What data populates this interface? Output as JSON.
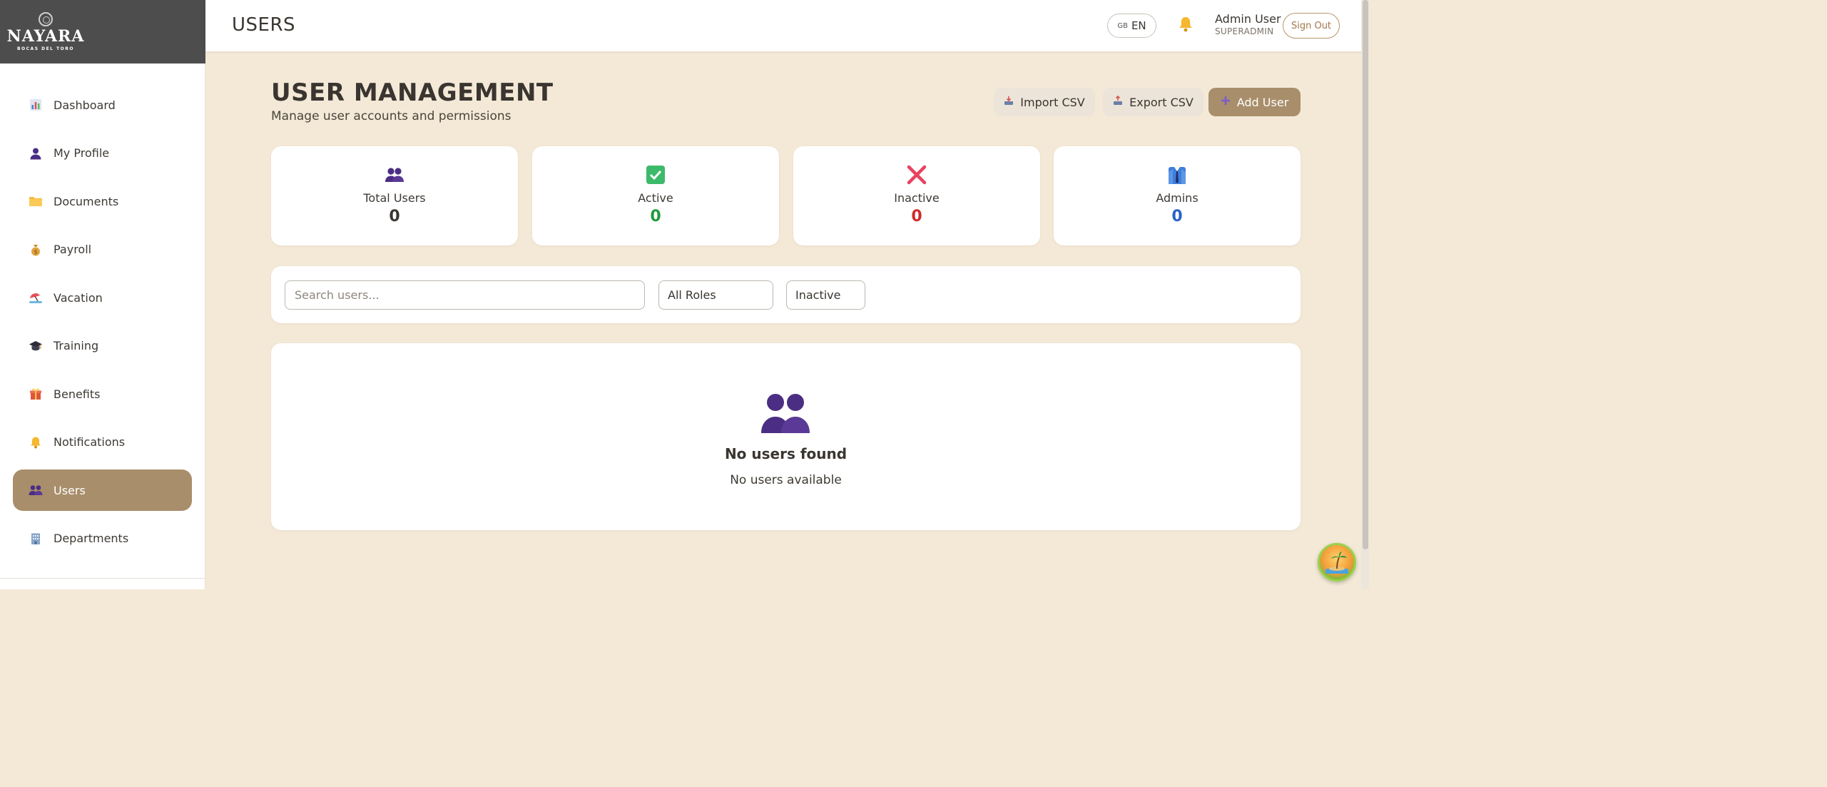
{
  "brand": {
    "name": "NAYARA",
    "tagline": "BOCAS DEL TORO"
  },
  "sidebar": {
    "items": [
      {
        "label": "Dashboard",
        "icon": "bar-chart-icon",
        "active": false
      },
      {
        "label": "My Profile",
        "icon": "person-icon",
        "active": false
      },
      {
        "label": "Documents",
        "icon": "folder-icon",
        "active": false
      },
      {
        "label": "Payroll",
        "icon": "money-bag-icon",
        "active": false
      },
      {
        "label": "Vacation",
        "icon": "beach-icon",
        "active": false
      },
      {
        "label": "Training",
        "icon": "graduation-cap-icon",
        "active": false
      },
      {
        "label": "Benefits",
        "icon": "gift-icon",
        "active": false
      },
      {
        "label": "Notifications",
        "icon": "bell-icon",
        "active": false
      },
      {
        "label": "Users",
        "icon": "users-icon",
        "active": true
      },
      {
        "label": "Departments",
        "icon": "building-icon",
        "active": false
      }
    ]
  },
  "topbar": {
    "title": "USERS",
    "language_flag": "GB",
    "language": "EN",
    "user_name": "Admin User",
    "user_role": "SUPERADMIN",
    "sign_out_label": "Sign Out"
  },
  "page": {
    "heading": "USER MANAGEMENT",
    "subheading": "Manage user accounts and permissions",
    "import_label": "Import CSV",
    "export_label": "Export CSV",
    "add_label": "Add User"
  },
  "stats": [
    {
      "label": "Total Users",
      "value": "0",
      "color": "#3a3530",
      "icon": "users-icon"
    },
    {
      "label": "Active",
      "value": "0",
      "color": "#1f9a3f",
      "icon": "check-icon"
    },
    {
      "label": "Inactive",
      "value": "0",
      "color": "#d12a2a",
      "icon": "cross-icon"
    },
    {
      "label": "Admins",
      "value": "0",
      "color": "#2a62c9",
      "icon": "admin-icon"
    }
  ],
  "filters": {
    "search_placeholder": "Search users...",
    "role_value": "All Roles",
    "status_value": "Inactive"
  },
  "empty_state": {
    "title": "No users found",
    "message": "No users available"
  },
  "colors": {
    "background": "#f4e9d7",
    "accent": "#a88e6a",
    "sidebar_header": "#4d4d4d"
  }
}
